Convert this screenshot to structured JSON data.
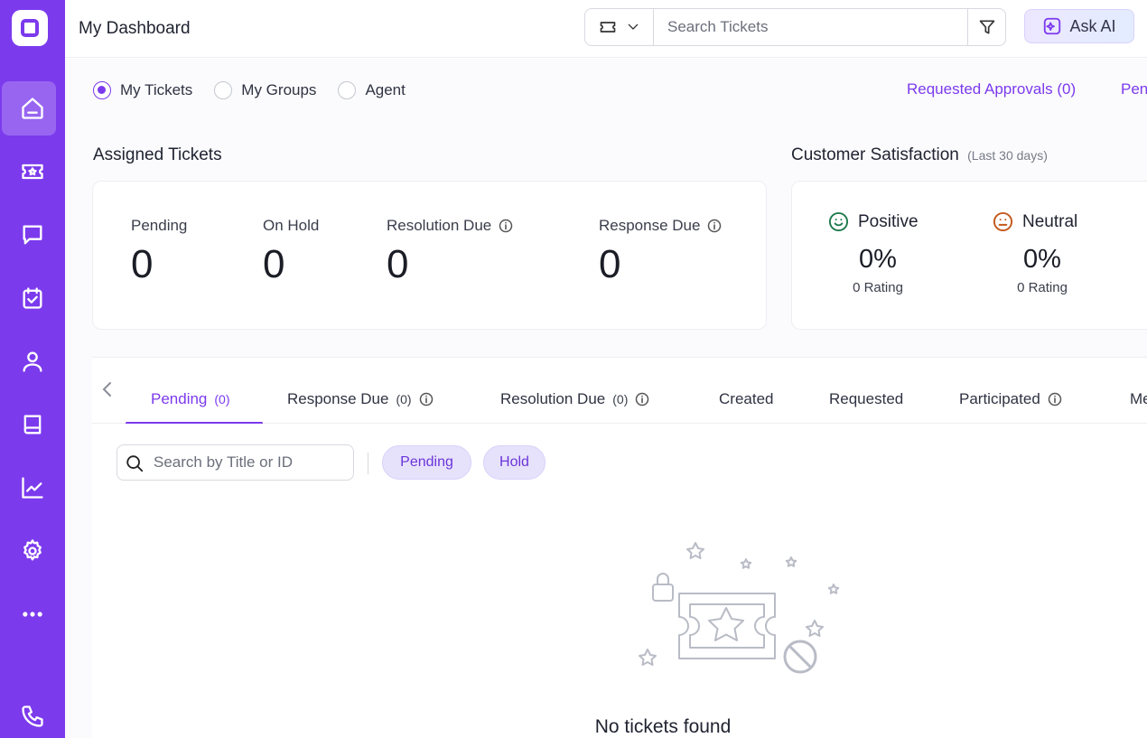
{
  "header": {
    "title": "My Dashboard",
    "search_placeholder": "Search Tickets",
    "ask_ai_label": "Ask AI"
  },
  "sidebar": {
    "items": [
      {
        "name": "home",
        "icon": "home-icon",
        "active": true
      },
      {
        "name": "tickets",
        "icon": "ticket-icon",
        "active": false
      },
      {
        "name": "conversations",
        "icon": "chat-icon",
        "active": false
      },
      {
        "name": "tasks",
        "icon": "calendar-check-icon",
        "active": false
      },
      {
        "name": "contacts",
        "icon": "user-icon",
        "active": false
      },
      {
        "name": "knowledge-base",
        "icon": "book-icon",
        "active": false
      },
      {
        "name": "reports",
        "icon": "chart-line-icon",
        "active": false
      },
      {
        "name": "settings",
        "icon": "gear-icon",
        "active": false
      },
      {
        "name": "more",
        "icon": "more-icon",
        "active": false
      },
      {
        "name": "phone",
        "icon": "phone-icon",
        "active": false
      }
    ]
  },
  "scope": {
    "options": [
      {
        "label": "My Tickets",
        "checked": true
      },
      {
        "label": "My Groups",
        "checked": false
      },
      {
        "label": "Agent",
        "checked": false
      }
    ],
    "requested_approvals": "Requested Approvals (0)",
    "pending_link": "Pen"
  },
  "assigned": {
    "title": "Assigned Tickets",
    "stats": [
      {
        "label": "Pending",
        "value": "0"
      },
      {
        "label": "On Hold",
        "value": "0"
      },
      {
        "label": "Resolution Due",
        "value": "0"
      },
      {
        "label": "Response Due",
        "value": "0"
      }
    ]
  },
  "csat": {
    "title": "Customer Satisfaction",
    "subtitle": "(Last 30 days)",
    "items": [
      {
        "label": "Positive",
        "percent": "0%",
        "rating": "0 Rating",
        "color": "#1f7a4d"
      },
      {
        "label": "Neutral",
        "percent": "0%",
        "rating": "0 Rating",
        "color": "#c2571a"
      }
    ]
  },
  "tabs": [
    {
      "label": "Pending",
      "count": "(0)",
      "active": true
    },
    {
      "label": "Response Due",
      "count": "(0)",
      "info": true
    },
    {
      "label": "Resolution Due",
      "count": "(0)",
      "info": true
    },
    {
      "label": "Created"
    },
    {
      "label": "Requested"
    },
    {
      "label": "Participated",
      "info": true
    },
    {
      "label": "Me"
    }
  ],
  "list": {
    "search_placeholder": "Search by Title or ID",
    "chips": [
      "Pending",
      "Hold"
    ],
    "empty_text": "No tickets found"
  },
  "colors": {
    "accent": "#7c3aed",
    "sidebar": "#7c3aed"
  }
}
